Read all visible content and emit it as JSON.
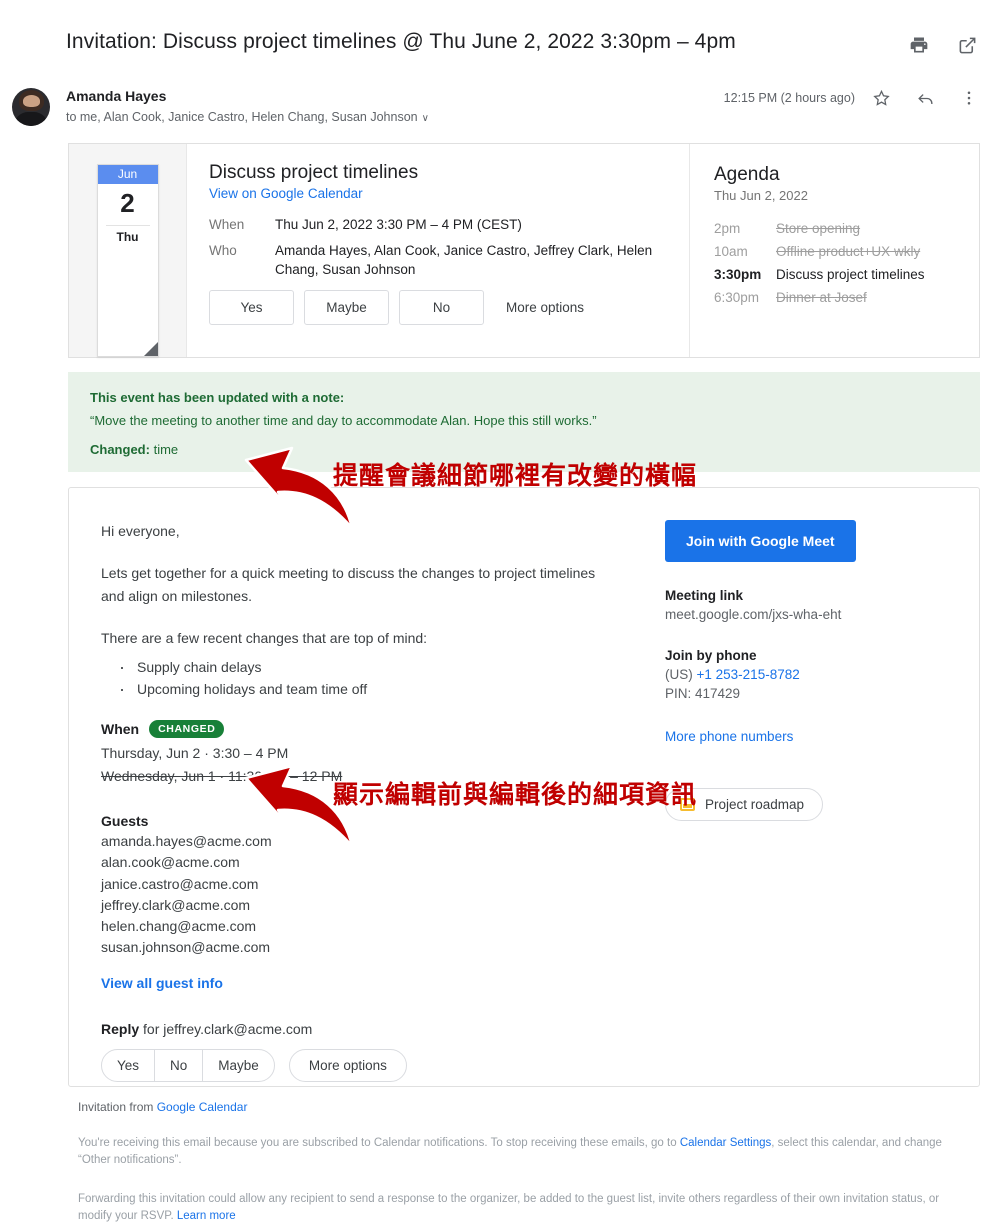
{
  "header": {
    "subject": "Invitation: Discuss project timelines @ Thu June 2, 2022 3:30pm – 4pm",
    "print_icon": "print-icon",
    "open_in_new_icon": "open-in-new-icon"
  },
  "sender": {
    "name": "Amanda Hayes",
    "recipients": "to me, Alan Cook, Janice Castro, Helen Chang, Susan Johnson",
    "caret": "∨",
    "timestamp": "12:15 PM (2 hours ago)"
  },
  "event": {
    "calendar_badge": {
      "month": "Jun",
      "day": "2",
      "weekday": "Thu"
    },
    "title": "Discuss project timelines",
    "view_link": "View on Google Calendar",
    "when_label": "When",
    "when_value": "Thu Jun 2, 2022 3:30 PM – 4 PM (CEST)",
    "who_label": "Who",
    "who_value": "Amanda Hayes, Alan Cook, Janice Castro, Jeffrey Clark, Helen Chang, Susan Johnson",
    "rsvp": {
      "yes": "Yes",
      "maybe": "Maybe",
      "no": "No",
      "more": "More options"
    }
  },
  "agenda": {
    "title": "Agenda",
    "date": "Thu Jun 2, 2022",
    "items": [
      {
        "time": "2pm",
        "name": "Store opening",
        "current": false
      },
      {
        "time": "10am",
        "name": "Offline product+UX wkly",
        "current": false
      },
      {
        "time": "3:30pm",
        "name": "Discuss project timelines",
        "current": true
      },
      {
        "time": "6:30pm",
        "name": "Dinner at Josef",
        "current": false
      }
    ]
  },
  "notice": {
    "heading": "This event has been updated with a note:",
    "note": "“Move the meeting to another time and day to accommodate Alan. Hope this still works.”",
    "changed_label": "Changed:",
    "changed_value": "time",
    "background": "#e8f2e9",
    "text_color": "#1e6b34"
  },
  "body": {
    "greeting": "Hi everyone,",
    "paragraph1": "Lets get together for a quick meeting to discuss the changes to project timelines and align on milestones.",
    "paragraph2": "There are a few recent changes that are top of mind:",
    "bullets": [
      "Supply chain delays",
      "Upcoming holidays and team time off"
    ],
    "when_label": "When",
    "changed_badge": "CHANGED",
    "when_new": "Thursday, Jun 2 · 3:30 – 4 PM",
    "when_old": "Wednesday, Jun 1 · 11:30 AM – 12 PM",
    "guests_label": "Guests",
    "guests": [
      "amanda.hayes@acme.com",
      "alan.cook@acme.com",
      "janice.castro@acme.com",
      "jeffrey.clark@acme.com",
      "helen.chang@acme.com",
      "susan.johnson@acme.com"
    ],
    "view_all_guests": "View all guest info",
    "reply_label": "Reply",
    "reply_for": "for jeffrey.clark@acme.com",
    "reply_buttons": {
      "yes": "Yes",
      "no": "No",
      "maybe": "Maybe",
      "more": "More options"
    }
  },
  "meeting": {
    "join_button": "Join with Google Meet",
    "link_label": "Meeting link",
    "link_value": "meet.google.com/jxs-wha-eht",
    "phone_label": "Join by phone",
    "phone_country": "(US)",
    "phone_number": "+1 253-215-8782",
    "pin": "PIN: 417429",
    "more_numbers": "More phone numbers",
    "attachment": "Project roadmap",
    "accent": "#1a73e8"
  },
  "footer": {
    "invitation_from": "Invitation from",
    "invitation_link": "Google Calendar",
    "para1_a": "You're receiving this email because you are subscribed to Calendar notifications. To stop receiving these emails, go to ",
    "para1_link": "Calendar Settings",
    "para1_b": ", select this calendar, and change “Other notifications”.",
    "para2_a": "Forwarding this invitation could allow any recipient to send a response to the organizer, be added to the guest list, invite others regardless of their own invitation status, or modify your RSVP. ",
    "para2_link": "Learn more"
  },
  "annotations": {
    "color": "#c00000",
    "note1": "提醒會議細節哪裡有改變的橫幅",
    "note2": "顯示編輯前與編輯後的細項資訊"
  }
}
